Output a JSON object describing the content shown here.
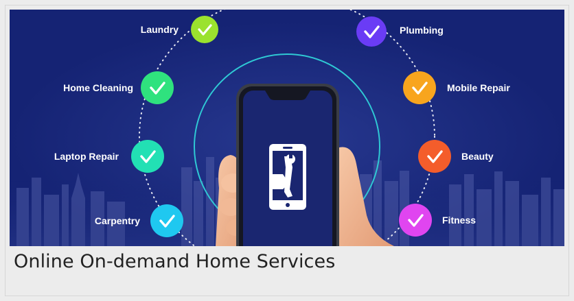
{
  "banner": {
    "left_services": [
      {
        "label": "Laundry",
        "color": "#9be22e"
      },
      {
        "label": "Home Cleaning",
        "color": "#2fe27e"
      },
      {
        "label": "Laptop Repair",
        "color": "#22e0b4"
      },
      {
        "label": "Carpentry",
        "color": "#1fc8f0"
      }
    ],
    "right_services": [
      {
        "label": "Plumbing",
        "color": "#6a3cf5"
      },
      {
        "label": "Mobile Repair",
        "color": "#f8a51e"
      },
      {
        "label": "Beauty",
        "color": "#f45d2b"
      },
      {
        "label": "Fitness",
        "color": "#e045f0"
      }
    ],
    "background_color": "#152374",
    "accent_ring_color": "#2fc9d4",
    "phone_icon": "smartphone-wrench-icon",
    "check_icon": "checkmark-icon"
  },
  "caption": {
    "title": "Online On-demand Home Services"
  }
}
